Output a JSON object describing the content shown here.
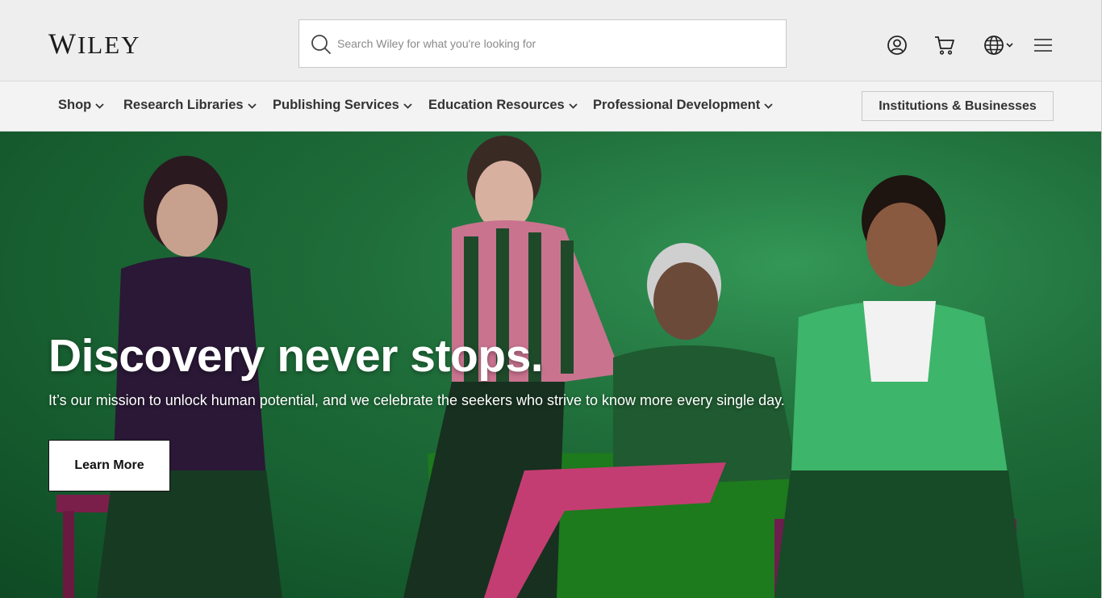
{
  "header": {
    "logo_text": "Wiley",
    "search": {
      "placeholder": "Search Wiley for what you're looking for"
    },
    "icons": [
      "search-icon",
      "account-icon",
      "cart-icon",
      "globe-icon",
      "chevron-down-icon",
      "hamburger-menu-icon"
    ]
  },
  "nav": {
    "items": [
      {
        "label": "Shop"
      },
      {
        "label": "Research Libraries"
      },
      {
        "label": "Publishing Services"
      },
      {
        "label": "Education Resources"
      },
      {
        "label": "Professional Development"
      }
    ],
    "institutions_label": "Institutions & Businesses"
  },
  "hero": {
    "title": "Discovery never stops.",
    "subtitle": "It’s our mission to unlock human potential, and we celebrate the seekers who strive to know more every single day.",
    "cta_label": "Learn More"
  },
  "colors": {
    "header_bg": "#eeeeee",
    "nav_bg": "#f3f3f3",
    "hero_green": "#1f6e3a",
    "text_dark": "#333333"
  }
}
